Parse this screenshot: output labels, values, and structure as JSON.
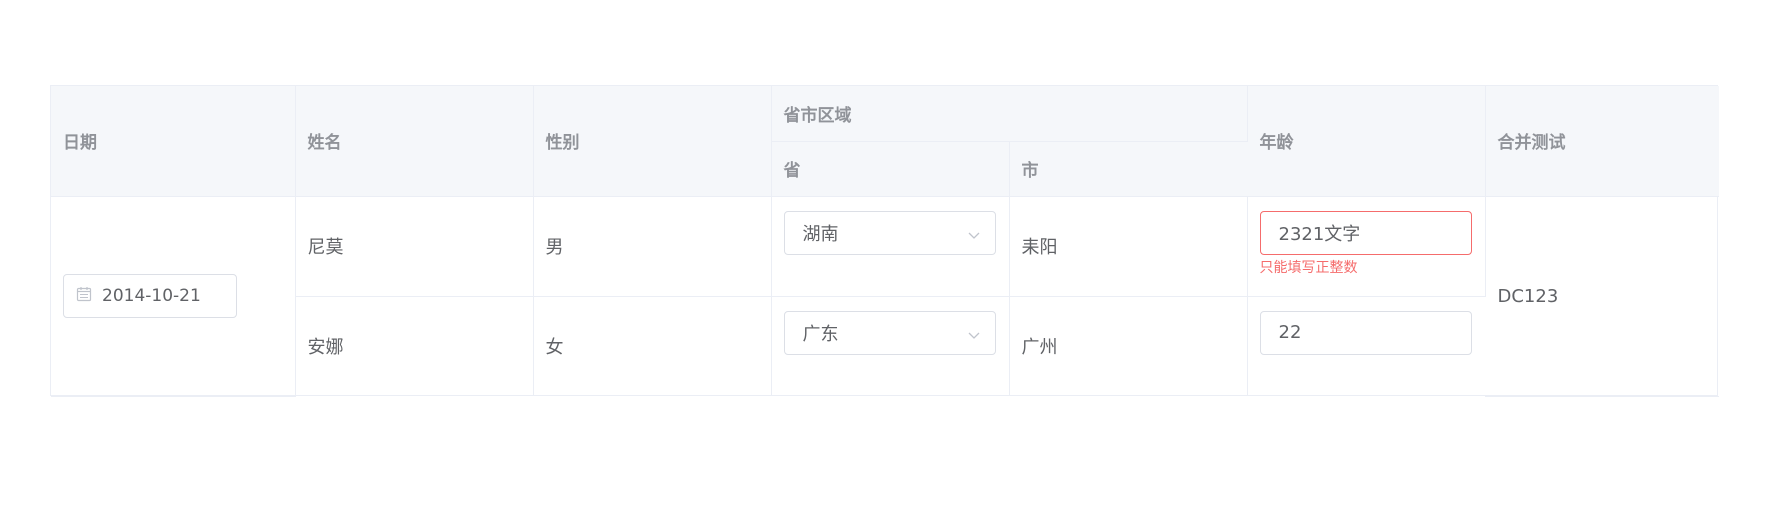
{
  "table": {
    "headers": {
      "date": "日期",
      "name": "姓名",
      "gender": "性别",
      "region_group": "省市区域",
      "province": "省",
      "city": "市",
      "age": "年龄",
      "merge_test": "合并测试"
    },
    "merged_date": "2014-10-21",
    "merged_test_value": "DC123",
    "rows": [
      {
        "name": "尼莫",
        "gender": "男",
        "province": "湖南",
        "city": "耒阳",
        "age": "2321文字",
        "age_error": "只能填写正整数"
      },
      {
        "name": "安娜",
        "gender": "女",
        "province": "广东",
        "city": "广州",
        "age": "22"
      }
    ]
  },
  "colors": {
    "header_bg": "#f5f7fa",
    "border": "#ebeef5",
    "error": "#f56c6c",
    "text": "#606266",
    "header_text": "#909399"
  },
  "icons": {
    "date": "calendar-icon",
    "select": "chevron-down-icon"
  }
}
